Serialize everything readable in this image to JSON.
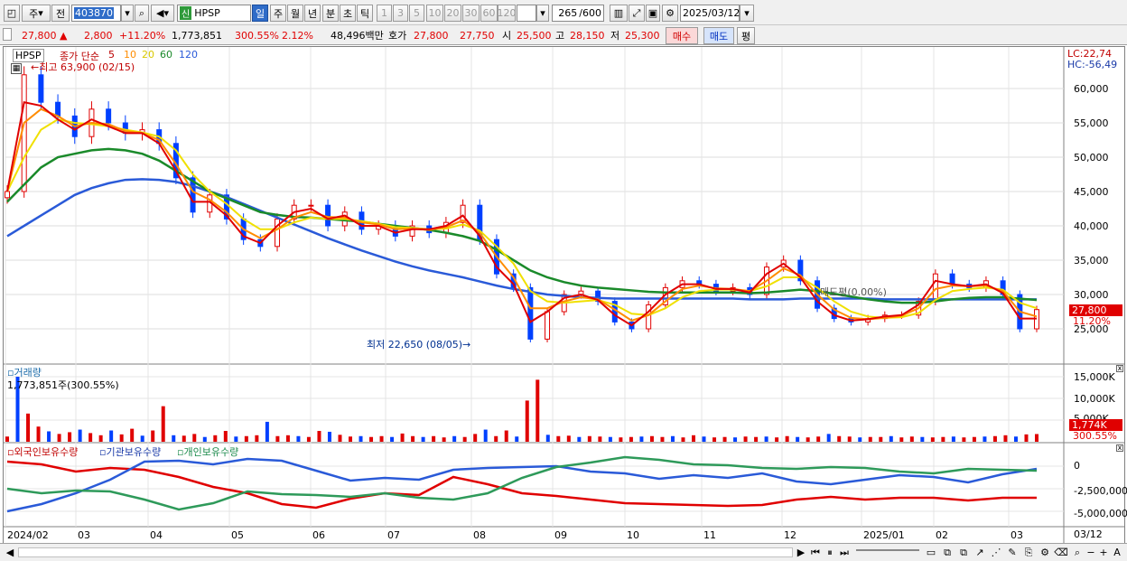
{
  "toolbar": {
    "stock_code": "403870",
    "stock_name": "HPSP",
    "mode_label": "주",
    "prev_label": "전",
    "new_badge": "신",
    "periods": [
      "일",
      "주",
      "월",
      "년",
      "분",
      "초",
      "틱"
    ],
    "intervals": [
      "1",
      "3",
      "5",
      "10",
      "20",
      "30",
      "60",
      "120"
    ],
    "count": "265",
    "count_total": "/600",
    "date": "2025/03/12"
  },
  "quote": {
    "price": "27,800",
    "change": "2,800",
    "change_pct": "+11.20%",
    "volume": "1,773,851",
    "volume_ratio": "300.55%",
    "turnover_pct": "2.12%",
    "amount": "48,496백만",
    "bid_label": "호가",
    "ask": "27,800",
    "bid": "27,750",
    "open_label": "시",
    "open": "25,500",
    "high_label": "고",
    "high": "28,150",
    "low_label": "저",
    "low": "25,300",
    "buy_label": "매수",
    "sell_label": "매도",
    "eval_label": "평"
  },
  "price_panel": {
    "symbol": "HPSP",
    "ma_label": "종가 단순",
    "ma_periods": [
      "5",
      "10",
      "20",
      "60",
      "120"
    ],
    "max_label": "최고 63,900 (02/15)",
    "min_label": "최저 22,650 (08/05)",
    "lc": "LC:22,74",
    "hc": "HC:-56,49",
    "avg_label": "매도평(0.00%)",
    "current_price": "27,800",
    "current_pct": "11.20%",
    "y_ticks": [
      "60,000",
      "55,000",
      "50,000",
      "45,000",
      "40,000",
      "35,000",
      "30,000",
      "25,000"
    ]
  },
  "volume_panel": {
    "title": "거래량",
    "value": "1,773,851주(300.55%)",
    "y_ticks": [
      "15,000K",
      "10,000K",
      "5,000K"
    ],
    "current": "1,774K",
    "current_pct": "300.55%"
  },
  "flow_panel": {
    "foreign": "외국인보유수량",
    "inst": "기관보유수량",
    "indiv": "개인보유수량",
    "y_ticks": [
      "0",
      "-2,500,000",
      "-5,000,000"
    ]
  },
  "x_axis": {
    "labels": [
      "2024/02",
      "03",
      "04",
      "05",
      "06",
      "07",
      "08",
      "09",
      "10",
      "11",
      "12",
      "2025/01",
      "02",
      "03"
    ],
    "end_label": "03/12"
  },
  "colors": {
    "up": "#e00000",
    "down": "#0040ff",
    "ma5": "#e00000",
    "ma10": "#ff8c00",
    "ma20": "#f0e000",
    "ma60": "#1a8a2a",
    "ma120": "#2a5ad8"
  },
  "chart_data": [
    {
      "type": "line",
      "title": "HPSP",
      "series": [
        {
          "name": "종가",
          "values": [
            45000,
            62000,
            58000,
            56000,
            53000,
            57000,
            55000,
            53500,
            54000,
            52000,
            47000,
            42000,
            44500,
            41000,
            38000,
            37000,
            41000,
            43000,
            43000,
            40000,
            42000,
            39500,
            40000,
            38500,
            40000,
            39000,
            40500,
            43000,
            38000,
            33000,
            31000,
            23500,
            27500,
            30000,
            30500,
            29000,
            26000,
            25000,
            28500,
            31000,
            32000,
            31500,
            30500,
            31000,
            30000,
            34000,
            35000,
            32000,
            28000,
            26500,
            26000,
            26500,
            27000,
            27000,
            29000,
            33000,
            31500,
            31000,
            32000,
            30000,
            25000,
            27800
          ]
        },
        {
          "name": "5",
          "values": [
            45000,
            58000,
            57500,
            55500,
            54000,
            55500,
            54500,
            53500,
            53500,
            52000,
            48000,
            43500,
            43500,
            41500,
            38500,
            37500,
            40000,
            42000,
            42500,
            41000,
            41500,
            40000,
            40000,
            39000,
            39500,
            39500,
            40000,
            41500,
            38500,
            34000,
            31500,
            26000,
            27500,
            29500,
            30000,
            29200,
            27000,
            25500,
            27500,
            30000,
            31500,
            31500,
            30800,
            30800,
            30300,
            33000,
            34500,
            32500,
            29000,
            27000,
            26200,
            26400,
            26800,
            27000,
            28500,
            32000,
            31500,
            31200,
            31500,
            30200,
            26500,
            26500
          ]
        },
        {
          "name": "10",
          "values": [
            45000,
            55000,
            57000,
            56000,
            54500,
            55000,
            54800,
            53800,
            53500,
            52500,
            49000,
            45000,
            43800,
            42000,
            39500,
            38200,
            39500,
            41200,
            42000,
            41300,
            41200,
            40500,
            40200,
            39500,
            39600,
            39400,
            39800,
            40800,
            39000,
            35500,
            32500,
            28000,
            28000,
            29000,
            29600,
            29300,
            27800,
            26200,
            27000,
            29000,
            30800,
            31300,
            30900,
            30800,
            30500,
            32000,
            33800,
            32800,
            30000,
            27800,
            26600,
            26400,
            26600,
            26900,
            28000,
            30800,
            31300,
            31200,
            31300,
            30500,
            27500,
            26800
          ]
        },
        {
          "name": "20",
          "values": [
            45000,
            50000,
            54000,
            55500,
            55000,
            54800,
            54500,
            54000,
            53600,
            53000,
            51000,
            47500,
            45000,
            43200,
            41000,
            39500,
            39500,
            40500,
            41200,
            41000,
            41000,
            40700,
            40300,
            39800,
            39700,
            39500,
            39600,
            40200,
            39300,
            37000,
            34500,
            30500,
            29000,
            28800,
            29000,
            29200,
            28500,
            27200,
            27000,
            28000,
            29600,
            30500,
            30700,
            30700,
            30500,
            31200,
            32500,
            32500,
            31000,
            29000,
            27500,
            26800,
            26600,
            26700,
            27300,
            29200,
            30500,
            30800,
            31000,
            30700,
            28800,
            28000
          ]
        },
        {
          "name": "60",
          "values": [
            43500,
            46000,
            48500,
            50000,
            50500,
            51000,
            51200,
            51000,
            50500,
            49500,
            48000,
            46500,
            45000,
            44000,
            43000,
            42000,
            41600,
            41300,
            41200,
            41000,
            40800,
            40600,
            40300,
            40000,
            39700,
            39400,
            39000,
            38500,
            37800,
            36500,
            35000,
            33500,
            32500,
            31800,
            31300,
            31000,
            30800,
            30600,
            30400,
            30300,
            30300,
            30300,
            30300,
            30300,
            30200,
            30300,
            30500,
            30700,
            30500,
            30100,
            29700,
            29300,
            29000,
            28800,
            28800,
            29000,
            29300,
            29500,
            29600,
            29600,
            29400,
            29200
          ]
        },
        {
          "name": "120",
          "values": [
            38500,
            40000,
            41500,
            43000,
            44500,
            45500,
            46200,
            46700,
            46800,
            46700,
            46400,
            45800,
            45000,
            44200,
            43200,
            42200,
            41200,
            40200,
            39200,
            38200,
            37300,
            36400,
            35600,
            34800,
            34100,
            33500,
            33000,
            32500,
            31900,
            31300,
            30800,
            30400,
            30000,
            29800,
            29600,
            29500,
            29400,
            29400,
            29400,
            29400,
            29400,
            29400,
            29400,
            29400,
            29300,
            29300,
            29300,
            29400,
            29400,
            29400,
            29400,
            29400,
            29300,
            29300,
            29300,
            29300,
            29300,
            29300,
            29300,
            29300,
            29300,
            29300
          ]
        }
      ]
    },
    {
      "type": "bar",
      "title": "거래량",
      "values": [
        1200,
        15000,
        6500,
        3500,
        2400,
        1800,
        2200,
        2800,
        2000,
        1500,
        2600,
        1700,
        3000,
        1400,
        2600,
        8200,
        1500,
        1400,
        1800,
        1100,
        1500,
        2500,
        1200,
        1300,
        1500,
        4600,
        1300,
        1500,
        1300,
        1100,
        2500,
        2300,
        1600,
        1200,
        1300,
        1100,
        1300,
        1100,
        1900,
        1300,
        1100,
        1300,
        1000,
        1300,
        1100,
        1800,
        2800,
        1300,
        2600,
        1200,
        9500,
        14300,
        1600,
        1300,
        1400,
        1100,
        1300,
        1200,
        1100,
        1000,
        1100,
        1200,
        1300,
        1100,
        1300,
        1000,
        1500,
        1200,
        1000,
        1100,
        1000,
        1200,
        1100,
        1200,
        1000,
        1300,
        1100,
        1000,
        1200,
        1800,
        1300,
        1200,
        1000,
        1100,
        1100,
        1300,
        1000,
        1200,
        1100,
        1000,
        1100,
        1200,
        1000,
        1100,
        1200,
        1300,
        1500,
        1200,
        1700,
        1774
      ]
    },
    {
      "type": "line",
      "title": "보유수량",
      "series": [
        {
          "name": "외국인보유수량",
          "values": [
            500000,
            200000,
            -600000,
            -200000,
            -400000,
            -1200000,
            -2300000,
            -3000000,
            -4200000,
            -4600000,
            -3600000,
            -3000000,
            -3200000,
            -1200000,
            -2000000,
            -3000000,
            -3300000,
            -3700000,
            -4100000,
            -4200000,
            -4300000,
            -4400000,
            -4300000,
            -3700000,
            -3400000,
            -3700000,
            -3500000,
            -3500000,
            -3800000,
            -3500000,
            -3500000
          ]
        },
        {
          "name": "기관보유수량",
          "values": [
            -5000000,
            -4200000,
            -3000000,
            -1500000,
            500000,
            600000,
            200000,
            800000,
            600000,
            -500000,
            -1600000,
            -1300000,
            -1500000,
            -400000,
            -200000,
            -100000,
            0,
            -600000,
            -800000,
            -1400000,
            -1000000,
            -1300000,
            -800000,
            -1700000,
            -2000000,
            -1500000,
            -1000000,
            -1200000,
            -1800000,
            -900000,
            -300000
          ]
        },
        {
          "name": "개인보유수량",
          "values": [
            -2500000,
            -3000000,
            -2700000,
            -2800000,
            -3700000,
            -4800000,
            -4100000,
            -2800000,
            -3100000,
            -3200000,
            -3400000,
            -3000000,
            -3500000,
            -3700000,
            -3000000,
            -1300000,
            -100000,
            400000,
            1000000,
            700000,
            200000,
            100000,
            -200000,
            -300000,
            -100000,
            -200000,
            -600000,
            -800000,
            -300000,
            -400000,
            -500000
          ]
        }
      ]
    }
  ]
}
